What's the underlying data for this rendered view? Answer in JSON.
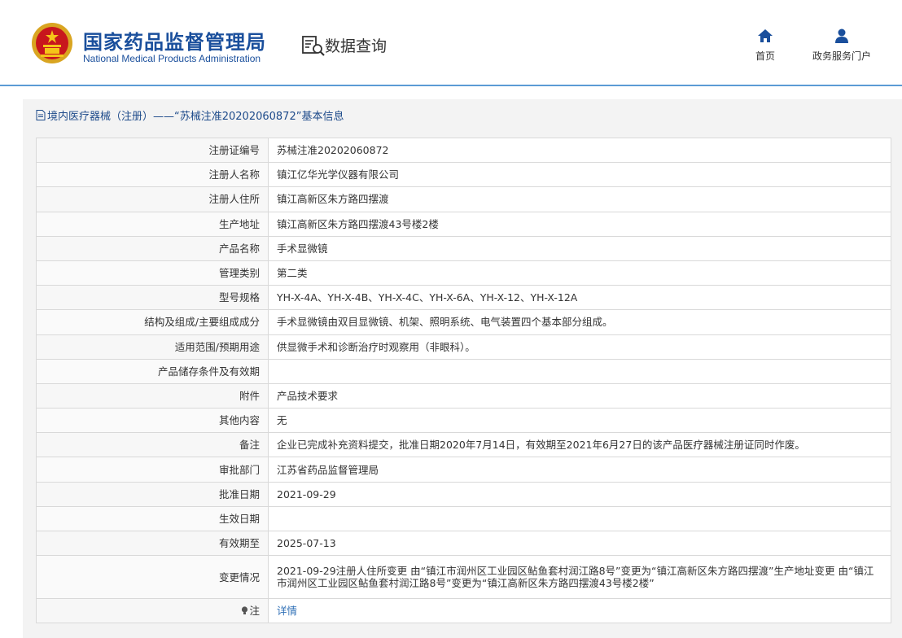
{
  "header": {
    "org_cn": "国家药品监督管理局",
    "org_en": "National Medical Products Administration",
    "section_title": "数据查询",
    "nav": [
      {
        "label": "首页",
        "icon": "home-icon"
      },
      {
        "label": "政务服务门户",
        "icon": "user-icon"
      }
    ]
  },
  "panel": {
    "title": "境内医疗器械（注册）——“苏械注准20202060872”基本信息"
  },
  "rows": [
    {
      "key": "注册证编号",
      "value": "苏械注准20202060872"
    },
    {
      "key": "注册人名称",
      "value": "镇江亿华光学仪器有限公司"
    },
    {
      "key": "注册人住所",
      "value": "镇江高新区朱方路四摆渡"
    },
    {
      "key": "生产地址",
      "value": "镇江高新区朱方路四摆渡43号楼2楼"
    },
    {
      "key": "产品名称",
      "value": "手术显微镜"
    },
    {
      "key": "管理类别",
      "value": "第二类"
    },
    {
      "key": "型号规格",
      "value": "YH-X-4A、YH-X-4B、YH-X-4C、YH-X-6A、YH-X-12、YH-X-12A"
    },
    {
      "key": "结构及组成/主要组成成分",
      "value": "手术显微镜由双目显微镜、机架、照明系统、电气装置四个基本部分组成。"
    },
    {
      "key": "适用范围/预期用途",
      "value": "供显微手术和诊断治疗时观察用（非眼科）。"
    },
    {
      "key": "产品储存条件及有效期",
      "value": ""
    },
    {
      "key": "附件",
      "value": "产品技术要求"
    },
    {
      "key": "其他内容",
      "value": "无"
    },
    {
      "key": "备注",
      "value": "企业已完成补充资料提交，批准日期2020年7月14日，有效期至2021年6月27日的该产品医疗器械注册证同时作废。"
    },
    {
      "key": "审批部门",
      "value": "江苏省药品监督管理局"
    },
    {
      "key": "批准日期",
      "value": "2021-09-29"
    },
    {
      "key": "生效日期",
      "value": ""
    },
    {
      "key": "有效期至",
      "value": "2025-07-13"
    },
    {
      "key": "变更情况",
      "value": "2021-09-29注册人住所变更 由“镇江市润州区工业园区鲇鱼套村润江路8号”变更为“镇江高新区朱方路四摆渡”生产地址变更 由“镇江市润州区工业园区鲇鱼套村润江路8号”变更为“镇江高新区朱方路四摆渡43号楼2楼”"
    }
  ],
  "note": {
    "key": "注",
    "link": "详情",
    "icon": "lightbulb-icon"
  },
  "colors": {
    "brand_blue": "#1a4f9c",
    "link_blue": "#2f6fb6",
    "header_rule": "#5b9bd5"
  }
}
